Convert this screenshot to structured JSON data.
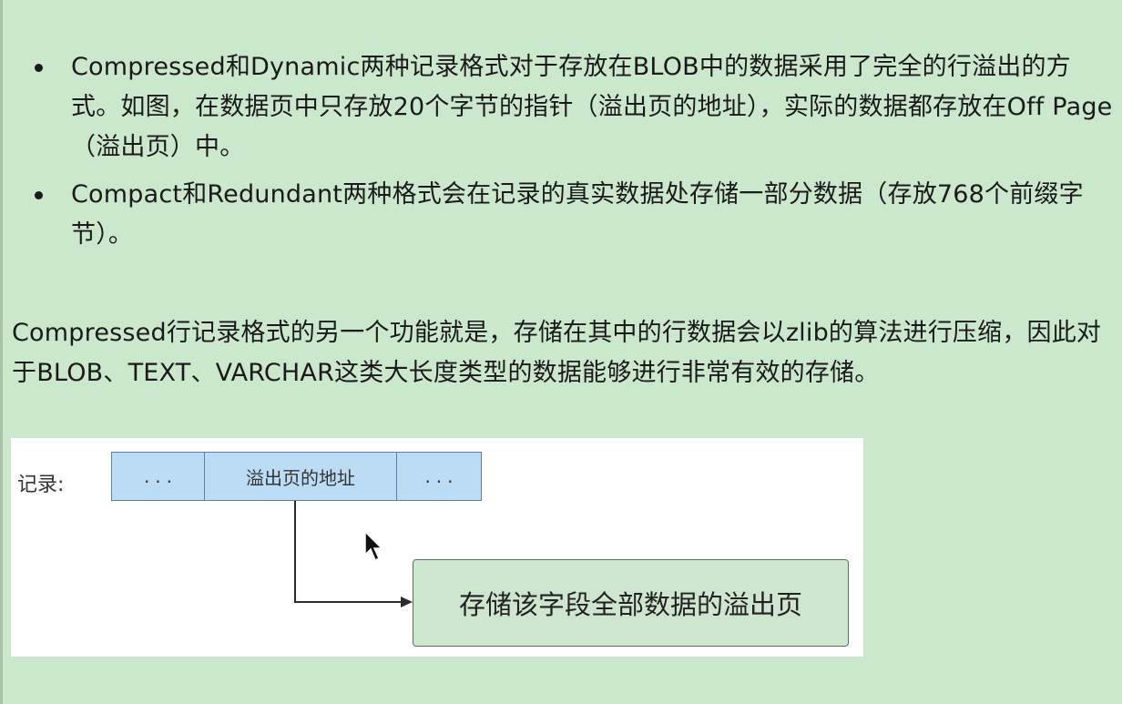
{
  "bullets": [
    {
      "text": "Compressed和Dynamic两种记录格式对于存放在BLOB中的数据采用了完全的行溢出的方式。如图，在数据页中只存放20个字节的指针（溢出页的地址），实际的数据都存放在Off Page（溢出页）中。"
    },
    {
      "text": "Compact和Redundant两种格式会在记录的真实数据处存储一部分数据（存放768个前缀字节）。"
    }
  ],
  "paragraph": "Compressed行记录格式的另一个功能就是，存储在其中的行数据会以zlib的算法进行压缩，因此对于BLOB、TEXT、VARCHAR这类大长度类型的数据能够进行非常有效的存储。",
  "figure": {
    "record_label": "记录:",
    "cells": [
      "...",
      "溢出页的地址",
      "..."
    ],
    "overflow_page": "存储该字段全部数据的溢出页"
  },
  "colors": {
    "background": "#cce8cc",
    "cell_fill": "#bcdcf6",
    "overflow_fill": "#cde6cd"
  }
}
